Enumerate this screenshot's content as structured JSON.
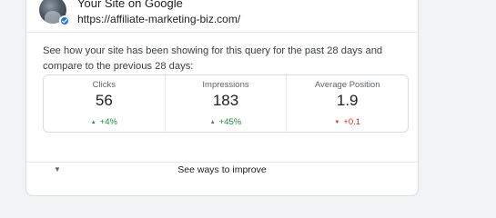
{
  "site": {
    "title": "Your Site on Google",
    "url": "https://affiliate-marketing-biz.com/"
  },
  "description": "See how your site has been showing for this query for the past 28 days and compare to the previous 28 days:",
  "stats": [
    {
      "label": "Clicks",
      "value": "56",
      "change": "+4%",
      "direction": "up"
    },
    {
      "label": "Impressions",
      "value": "183",
      "change": "+45%",
      "direction": "up"
    },
    {
      "label": "Average Position",
      "value": "1.9",
      "change": "+0.1",
      "direction": "down"
    }
  ],
  "improve": {
    "label": "See ways to improve"
  },
  "icons": {
    "up_arrow": "▲",
    "down_arrow": "▼",
    "expand": "▼",
    "verified": "checkmark-icon"
  },
  "colors": {
    "positive": "#1e8e3e",
    "negative": "#d93025",
    "verified": "#1a73e8"
  }
}
